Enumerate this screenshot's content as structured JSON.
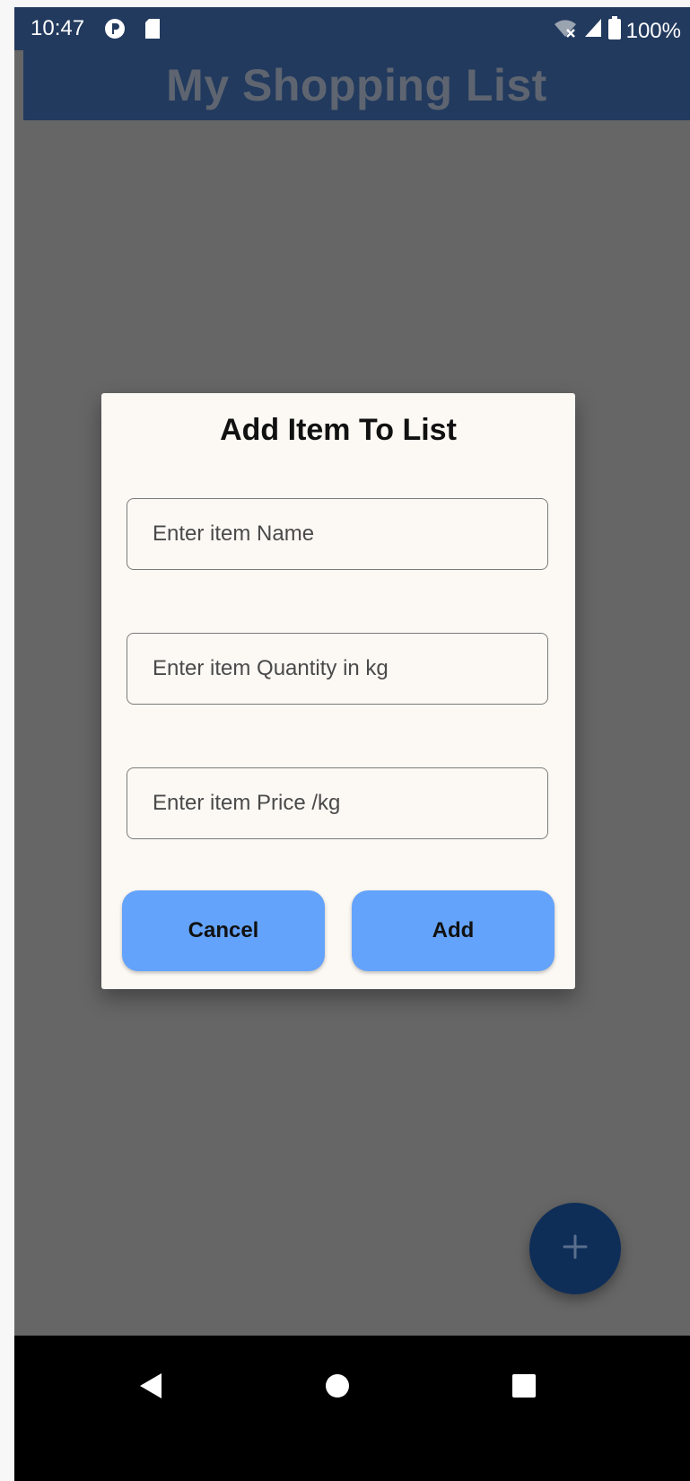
{
  "status_bar": {
    "time": "10:47",
    "left_icons": [
      "p-circle-icon",
      "sd-card-icon"
    ],
    "right_icons": [
      "wifi-off-icon",
      "signal-icon",
      "battery-icon"
    ],
    "battery": "100%"
  },
  "app_bar": {
    "title": "My Shopping List",
    "color": "#223a5e"
  },
  "dialog": {
    "title": "Add Item To List",
    "fields": [
      {
        "placeholder": "Enter item Name",
        "value": ""
      },
      {
        "placeholder": "Enter item Quantity in kg",
        "value": ""
      },
      {
        "placeholder": "Enter item Price /kg",
        "value": ""
      }
    ],
    "cancel_label": "Cancel",
    "add_label": "Add",
    "button_color": "#64a3fb"
  },
  "fab": {
    "icon": "plus-icon",
    "color": "#0e2e58"
  },
  "nav_bar": {
    "icons": [
      "back-icon",
      "home-icon",
      "recents-icon"
    ]
  }
}
